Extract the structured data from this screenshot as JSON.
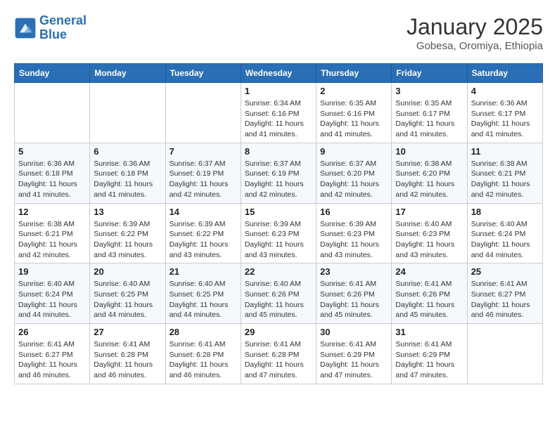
{
  "header": {
    "logo_line1": "General",
    "logo_line2": "Blue",
    "month": "January 2025",
    "location": "Gobesa, Oromiya, Ethiopia"
  },
  "weekdays": [
    "Sunday",
    "Monday",
    "Tuesday",
    "Wednesday",
    "Thursday",
    "Friday",
    "Saturday"
  ],
  "weeks": [
    [
      {
        "day": "",
        "sunrise": "",
        "sunset": "",
        "daylight": ""
      },
      {
        "day": "",
        "sunrise": "",
        "sunset": "",
        "daylight": ""
      },
      {
        "day": "",
        "sunrise": "",
        "sunset": "",
        "daylight": ""
      },
      {
        "day": "1",
        "sunrise": "Sunrise: 6:34 AM",
        "sunset": "Sunset: 6:16 PM",
        "daylight": "Daylight: 11 hours and 41 minutes."
      },
      {
        "day": "2",
        "sunrise": "Sunrise: 6:35 AM",
        "sunset": "Sunset: 6:16 PM",
        "daylight": "Daylight: 11 hours and 41 minutes."
      },
      {
        "day": "3",
        "sunrise": "Sunrise: 6:35 AM",
        "sunset": "Sunset: 6:17 PM",
        "daylight": "Daylight: 11 hours and 41 minutes."
      },
      {
        "day": "4",
        "sunrise": "Sunrise: 6:36 AM",
        "sunset": "Sunset: 6:17 PM",
        "daylight": "Daylight: 11 hours and 41 minutes."
      }
    ],
    [
      {
        "day": "5",
        "sunrise": "Sunrise: 6:36 AM",
        "sunset": "Sunset: 6:18 PM",
        "daylight": "Daylight: 11 hours and 41 minutes."
      },
      {
        "day": "6",
        "sunrise": "Sunrise: 6:36 AM",
        "sunset": "Sunset: 6:18 PM",
        "daylight": "Daylight: 11 hours and 41 minutes."
      },
      {
        "day": "7",
        "sunrise": "Sunrise: 6:37 AM",
        "sunset": "Sunset: 6:19 PM",
        "daylight": "Daylight: 11 hours and 42 minutes."
      },
      {
        "day": "8",
        "sunrise": "Sunrise: 6:37 AM",
        "sunset": "Sunset: 6:19 PM",
        "daylight": "Daylight: 11 hours and 42 minutes."
      },
      {
        "day": "9",
        "sunrise": "Sunrise: 6:37 AM",
        "sunset": "Sunset: 6:20 PM",
        "daylight": "Daylight: 11 hours and 42 minutes."
      },
      {
        "day": "10",
        "sunrise": "Sunrise: 6:38 AM",
        "sunset": "Sunset: 6:20 PM",
        "daylight": "Daylight: 11 hours and 42 minutes."
      },
      {
        "day": "11",
        "sunrise": "Sunrise: 6:38 AM",
        "sunset": "Sunset: 6:21 PM",
        "daylight": "Daylight: 11 hours and 42 minutes."
      }
    ],
    [
      {
        "day": "12",
        "sunrise": "Sunrise: 6:38 AM",
        "sunset": "Sunset: 6:21 PM",
        "daylight": "Daylight: 11 hours and 42 minutes."
      },
      {
        "day": "13",
        "sunrise": "Sunrise: 6:39 AM",
        "sunset": "Sunset: 6:22 PM",
        "daylight": "Daylight: 11 hours and 43 minutes."
      },
      {
        "day": "14",
        "sunrise": "Sunrise: 6:39 AM",
        "sunset": "Sunset: 6:22 PM",
        "daylight": "Daylight: 11 hours and 43 minutes."
      },
      {
        "day": "15",
        "sunrise": "Sunrise: 6:39 AM",
        "sunset": "Sunset: 6:23 PM",
        "daylight": "Daylight: 11 hours and 43 minutes."
      },
      {
        "day": "16",
        "sunrise": "Sunrise: 6:39 AM",
        "sunset": "Sunset: 6:23 PM",
        "daylight": "Daylight: 11 hours and 43 minutes."
      },
      {
        "day": "17",
        "sunrise": "Sunrise: 6:40 AM",
        "sunset": "Sunset: 6:23 PM",
        "daylight": "Daylight: 11 hours and 43 minutes."
      },
      {
        "day": "18",
        "sunrise": "Sunrise: 6:40 AM",
        "sunset": "Sunset: 6:24 PM",
        "daylight": "Daylight: 11 hours and 44 minutes."
      }
    ],
    [
      {
        "day": "19",
        "sunrise": "Sunrise: 6:40 AM",
        "sunset": "Sunset: 6:24 PM",
        "daylight": "Daylight: 11 hours and 44 minutes."
      },
      {
        "day": "20",
        "sunrise": "Sunrise: 6:40 AM",
        "sunset": "Sunset: 6:25 PM",
        "daylight": "Daylight: 11 hours and 44 minutes."
      },
      {
        "day": "21",
        "sunrise": "Sunrise: 6:40 AM",
        "sunset": "Sunset: 6:25 PM",
        "daylight": "Daylight: 11 hours and 44 minutes."
      },
      {
        "day": "22",
        "sunrise": "Sunrise: 6:40 AM",
        "sunset": "Sunset: 6:26 PM",
        "daylight": "Daylight: 11 hours and 45 minutes."
      },
      {
        "day": "23",
        "sunrise": "Sunrise: 6:41 AM",
        "sunset": "Sunset: 6:26 PM",
        "daylight": "Daylight: 11 hours and 45 minutes."
      },
      {
        "day": "24",
        "sunrise": "Sunrise: 6:41 AM",
        "sunset": "Sunset: 6:26 PM",
        "daylight": "Daylight: 11 hours and 45 minutes."
      },
      {
        "day": "25",
        "sunrise": "Sunrise: 6:41 AM",
        "sunset": "Sunset: 6:27 PM",
        "daylight": "Daylight: 11 hours and 46 minutes."
      }
    ],
    [
      {
        "day": "26",
        "sunrise": "Sunrise: 6:41 AM",
        "sunset": "Sunset: 6:27 PM",
        "daylight": "Daylight: 11 hours and 46 minutes."
      },
      {
        "day": "27",
        "sunrise": "Sunrise: 6:41 AM",
        "sunset": "Sunset: 6:28 PM",
        "daylight": "Daylight: 11 hours and 46 minutes."
      },
      {
        "day": "28",
        "sunrise": "Sunrise: 6:41 AM",
        "sunset": "Sunset: 6:28 PM",
        "daylight": "Daylight: 11 hours and 46 minutes."
      },
      {
        "day": "29",
        "sunrise": "Sunrise: 6:41 AM",
        "sunset": "Sunset: 6:28 PM",
        "daylight": "Daylight: 11 hours and 47 minutes."
      },
      {
        "day": "30",
        "sunrise": "Sunrise: 6:41 AM",
        "sunset": "Sunset: 6:29 PM",
        "daylight": "Daylight: 11 hours and 47 minutes."
      },
      {
        "day": "31",
        "sunrise": "Sunrise: 6:41 AM",
        "sunset": "Sunset: 6:29 PM",
        "daylight": "Daylight: 11 hours and 47 minutes."
      },
      {
        "day": "",
        "sunrise": "",
        "sunset": "",
        "daylight": ""
      }
    ]
  ]
}
